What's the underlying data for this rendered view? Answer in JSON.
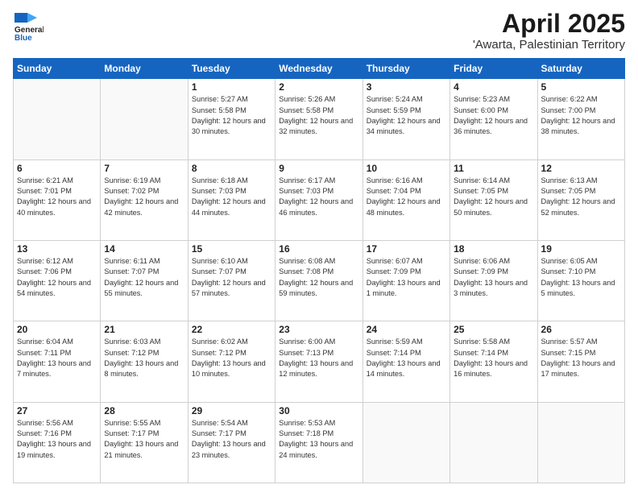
{
  "header": {
    "logo_general": "General",
    "logo_blue": "Blue",
    "title": "April 2025",
    "subtitle": "'Awarta, Palestinian Territory"
  },
  "calendar": {
    "days_of_week": [
      "Sunday",
      "Monday",
      "Tuesday",
      "Wednesday",
      "Thursday",
      "Friday",
      "Saturday"
    ],
    "weeks": [
      [
        {
          "day": "",
          "info": ""
        },
        {
          "day": "",
          "info": ""
        },
        {
          "day": "1",
          "info": "Sunrise: 5:27 AM\nSunset: 5:58 PM\nDaylight: 12 hours\nand 30 minutes."
        },
        {
          "day": "2",
          "info": "Sunrise: 5:26 AM\nSunset: 5:58 PM\nDaylight: 12 hours\nand 32 minutes."
        },
        {
          "day": "3",
          "info": "Sunrise: 5:24 AM\nSunset: 5:59 PM\nDaylight: 12 hours\nand 34 minutes."
        },
        {
          "day": "4",
          "info": "Sunrise: 5:23 AM\nSunset: 6:00 PM\nDaylight: 12 hours\nand 36 minutes."
        },
        {
          "day": "5",
          "info": "Sunrise: 6:22 AM\nSunset: 7:00 PM\nDaylight: 12 hours\nand 38 minutes."
        }
      ],
      [
        {
          "day": "6",
          "info": "Sunrise: 6:21 AM\nSunset: 7:01 PM\nDaylight: 12 hours\nand 40 minutes."
        },
        {
          "day": "7",
          "info": "Sunrise: 6:19 AM\nSunset: 7:02 PM\nDaylight: 12 hours\nand 42 minutes."
        },
        {
          "day": "8",
          "info": "Sunrise: 6:18 AM\nSunset: 7:03 PM\nDaylight: 12 hours\nand 44 minutes."
        },
        {
          "day": "9",
          "info": "Sunrise: 6:17 AM\nSunset: 7:03 PM\nDaylight: 12 hours\nand 46 minutes."
        },
        {
          "day": "10",
          "info": "Sunrise: 6:16 AM\nSunset: 7:04 PM\nDaylight: 12 hours\nand 48 minutes."
        },
        {
          "day": "11",
          "info": "Sunrise: 6:14 AM\nSunset: 7:05 PM\nDaylight: 12 hours\nand 50 minutes."
        },
        {
          "day": "12",
          "info": "Sunrise: 6:13 AM\nSunset: 7:05 PM\nDaylight: 12 hours\nand 52 minutes."
        }
      ],
      [
        {
          "day": "13",
          "info": "Sunrise: 6:12 AM\nSunset: 7:06 PM\nDaylight: 12 hours\nand 54 minutes."
        },
        {
          "day": "14",
          "info": "Sunrise: 6:11 AM\nSunset: 7:07 PM\nDaylight: 12 hours\nand 55 minutes."
        },
        {
          "day": "15",
          "info": "Sunrise: 6:10 AM\nSunset: 7:07 PM\nDaylight: 12 hours\nand 57 minutes."
        },
        {
          "day": "16",
          "info": "Sunrise: 6:08 AM\nSunset: 7:08 PM\nDaylight: 12 hours\nand 59 minutes."
        },
        {
          "day": "17",
          "info": "Sunrise: 6:07 AM\nSunset: 7:09 PM\nDaylight: 13 hours\nand 1 minute."
        },
        {
          "day": "18",
          "info": "Sunrise: 6:06 AM\nSunset: 7:09 PM\nDaylight: 13 hours\nand 3 minutes."
        },
        {
          "day": "19",
          "info": "Sunrise: 6:05 AM\nSunset: 7:10 PM\nDaylight: 13 hours\nand 5 minutes."
        }
      ],
      [
        {
          "day": "20",
          "info": "Sunrise: 6:04 AM\nSunset: 7:11 PM\nDaylight: 13 hours\nand 7 minutes."
        },
        {
          "day": "21",
          "info": "Sunrise: 6:03 AM\nSunset: 7:12 PM\nDaylight: 13 hours\nand 8 minutes."
        },
        {
          "day": "22",
          "info": "Sunrise: 6:02 AM\nSunset: 7:12 PM\nDaylight: 13 hours\nand 10 minutes."
        },
        {
          "day": "23",
          "info": "Sunrise: 6:00 AM\nSunset: 7:13 PM\nDaylight: 13 hours\nand 12 minutes."
        },
        {
          "day": "24",
          "info": "Sunrise: 5:59 AM\nSunset: 7:14 PM\nDaylight: 13 hours\nand 14 minutes."
        },
        {
          "day": "25",
          "info": "Sunrise: 5:58 AM\nSunset: 7:14 PM\nDaylight: 13 hours\nand 16 minutes."
        },
        {
          "day": "26",
          "info": "Sunrise: 5:57 AM\nSunset: 7:15 PM\nDaylight: 13 hours\nand 17 minutes."
        }
      ],
      [
        {
          "day": "27",
          "info": "Sunrise: 5:56 AM\nSunset: 7:16 PM\nDaylight: 13 hours\nand 19 minutes."
        },
        {
          "day": "28",
          "info": "Sunrise: 5:55 AM\nSunset: 7:17 PM\nDaylight: 13 hours\nand 21 minutes."
        },
        {
          "day": "29",
          "info": "Sunrise: 5:54 AM\nSunset: 7:17 PM\nDaylight: 13 hours\nand 23 minutes."
        },
        {
          "day": "30",
          "info": "Sunrise: 5:53 AM\nSunset: 7:18 PM\nDaylight: 13 hours\nand 24 minutes."
        },
        {
          "day": "",
          "info": ""
        },
        {
          "day": "",
          "info": ""
        },
        {
          "day": "",
          "info": ""
        }
      ]
    ]
  }
}
